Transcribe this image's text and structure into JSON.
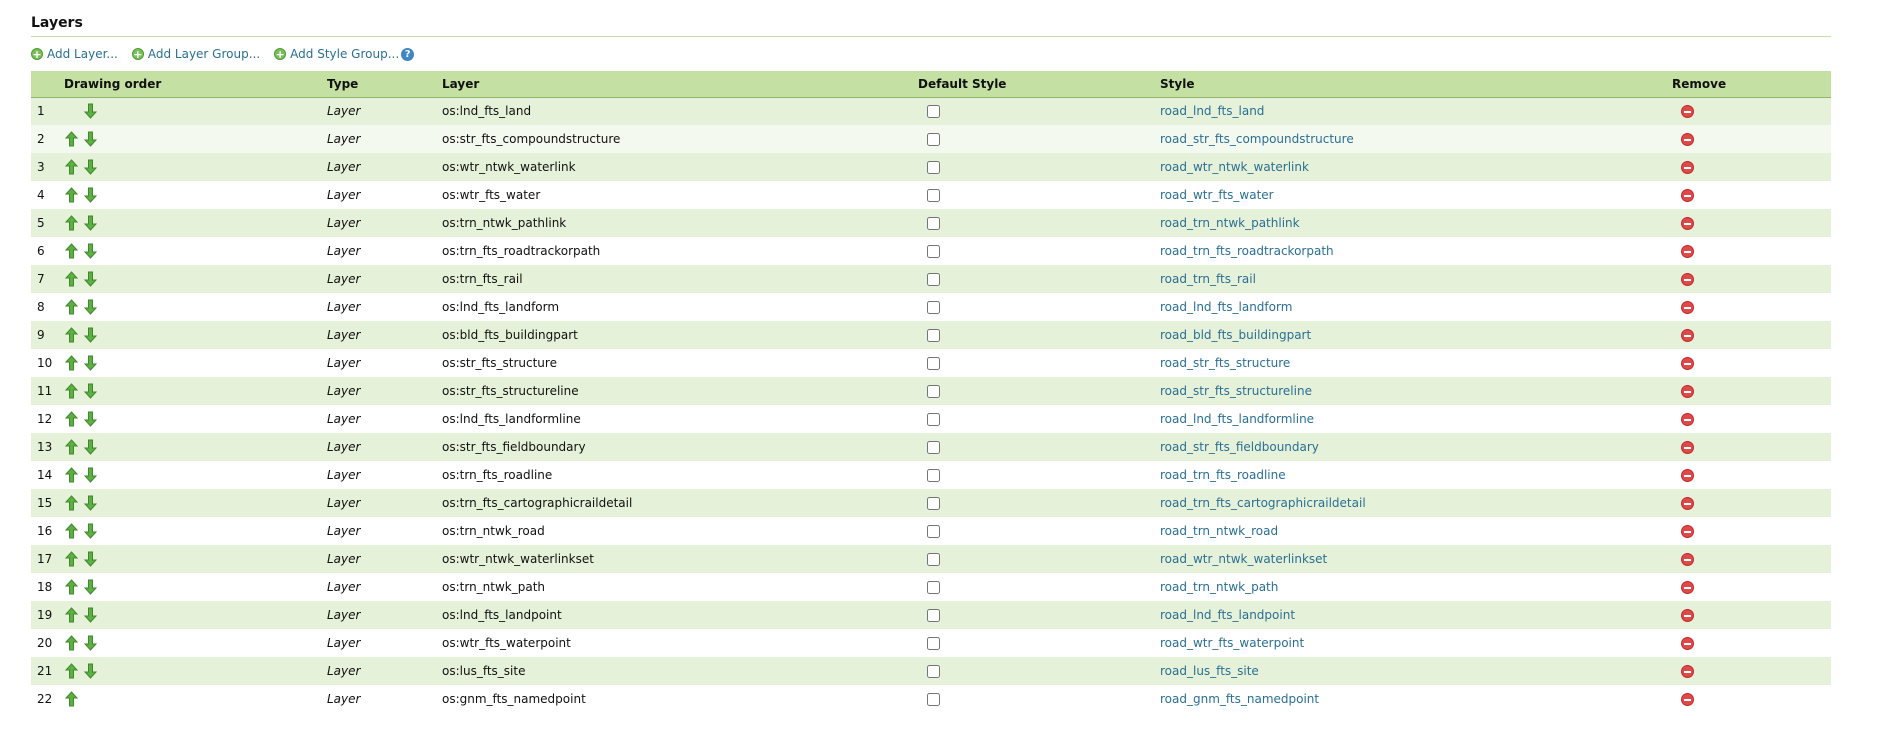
{
  "section": {
    "title": "Layers"
  },
  "toolbar": {
    "add_layer": "Add Layer...",
    "add_layer_group": "Add Layer Group...",
    "add_style_group": "Add Style Group..."
  },
  "table": {
    "headers": {
      "drawing_order": "Drawing order",
      "type": "Type",
      "layer": "Layer",
      "default_style": "Default Style",
      "style": "Style",
      "remove": "Remove"
    },
    "rows": [
      {
        "order": "1",
        "type": "Layer",
        "layer": "os:lnd_fts_land",
        "style": "road_lnd_fts_land",
        "up": false,
        "down": true,
        "default_style": false
      },
      {
        "order": "2",
        "type": "Layer",
        "layer": "os:str_fts_compoundstructure",
        "style": "road_str_fts_compoundstructure",
        "up": true,
        "down": true,
        "default_style": false
      },
      {
        "order": "3",
        "type": "Layer",
        "layer": "os:wtr_ntwk_waterlink",
        "style": "road_wtr_ntwk_waterlink",
        "up": true,
        "down": true,
        "default_style": false
      },
      {
        "order": "4",
        "type": "Layer",
        "layer": "os:wtr_fts_water",
        "style": "road_wtr_fts_water",
        "up": true,
        "down": true,
        "default_style": false
      },
      {
        "order": "5",
        "type": "Layer",
        "layer": "os:trn_ntwk_pathlink",
        "style": "road_trn_ntwk_pathlink",
        "up": true,
        "down": true,
        "default_style": false
      },
      {
        "order": "6",
        "type": "Layer",
        "layer": "os:trn_fts_roadtrackorpath",
        "style": "road_trn_fts_roadtrackorpath",
        "up": true,
        "down": true,
        "default_style": false
      },
      {
        "order": "7",
        "type": "Layer",
        "layer": "os:trn_fts_rail",
        "style": "road_trn_fts_rail",
        "up": true,
        "down": true,
        "default_style": false
      },
      {
        "order": "8",
        "type": "Layer",
        "layer": "os:lnd_fts_landform",
        "style": "road_lnd_fts_landform",
        "up": true,
        "down": true,
        "default_style": false
      },
      {
        "order": "9",
        "type": "Layer",
        "layer": "os:bld_fts_buildingpart",
        "style": "road_bld_fts_buildingpart",
        "up": true,
        "down": true,
        "default_style": false
      },
      {
        "order": "10",
        "type": "Layer",
        "layer": "os:str_fts_structure",
        "style": "road_str_fts_structure",
        "up": true,
        "down": true,
        "default_style": false
      },
      {
        "order": "11",
        "type": "Layer",
        "layer": "os:str_fts_structureline",
        "style": "road_str_fts_structureline",
        "up": true,
        "down": true,
        "default_style": false
      },
      {
        "order": "12",
        "type": "Layer",
        "layer": "os:lnd_fts_landformline",
        "style": "road_lnd_fts_landformline",
        "up": true,
        "down": true,
        "default_style": false
      },
      {
        "order": "13",
        "type": "Layer",
        "layer": "os:str_fts_fieldboundary",
        "style": "road_str_fts_fieldboundary",
        "up": true,
        "down": true,
        "default_style": false
      },
      {
        "order": "14",
        "type": "Layer",
        "layer": "os:trn_fts_roadline",
        "style": "road_trn_fts_roadline",
        "up": true,
        "down": true,
        "default_style": false
      },
      {
        "order": "15",
        "type": "Layer",
        "layer": "os:trn_fts_cartographicraildetail",
        "style": "road_trn_fts_cartographicraildetail",
        "up": true,
        "down": true,
        "default_style": false
      },
      {
        "order": "16",
        "type": "Layer",
        "layer": "os:trn_ntwk_road",
        "style": "road_trn_ntwk_road",
        "up": true,
        "down": true,
        "default_style": false
      },
      {
        "order": "17",
        "type": "Layer",
        "layer": "os:wtr_ntwk_waterlinkset",
        "style": "road_wtr_ntwk_waterlinkset",
        "up": true,
        "down": true,
        "default_style": false
      },
      {
        "order": "18",
        "type": "Layer",
        "layer": "os:trn_ntwk_path",
        "style": "road_trn_ntwk_path",
        "up": true,
        "down": true,
        "default_style": false
      },
      {
        "order": "19",
        "type": "Layer",
        "layer": "os:lnd_fts_landpoint",
        "style": "road_lnd_fts_landpoint",
        "up": true,
        "down": true,
        "default_style": false
      },
      {
        "order": "20",
        "type": "Layer",
        "layer": "os:wtr_fts_waterpoint",
        "style": "road_wtr_fts_waterpoint",
        "up": true,
        "down": true,
        "default_style": false
      },
      {
        "order": "21",
        "type": "Layer",
        "layer": "os:lus_fts_site",
        "style": "road_lus_fts_site",
        "up": true,
        "down": true,
        "default_style": false
      },
      {
        "order": "22",
        "type": "Layer",
        "layer": "os:gnm_fts_namedpoint",
        "style": "road_gnm_fts_namedpoint",
        "up": true,
        "down": false,
        "default_style": false
      }
    ]
  },
  "colors": {
    "header_bg": "#c5e0a3",
    "row_shaded": "#e6f1d9",
    "row_light": "#f4f9ef",
    "link": "#2a6f93",
    "arrow_green": "#4f9a36",
    "remove_red": "#e14848"
  },
  "icons": {
    "add": "add-circle-icon",
    "help": "help-icon",
    "move_up": "arrow-up-icon",
    "move_down": "arrow-down-icon",
    "remove": "remove-circle-icon"
  }
}
